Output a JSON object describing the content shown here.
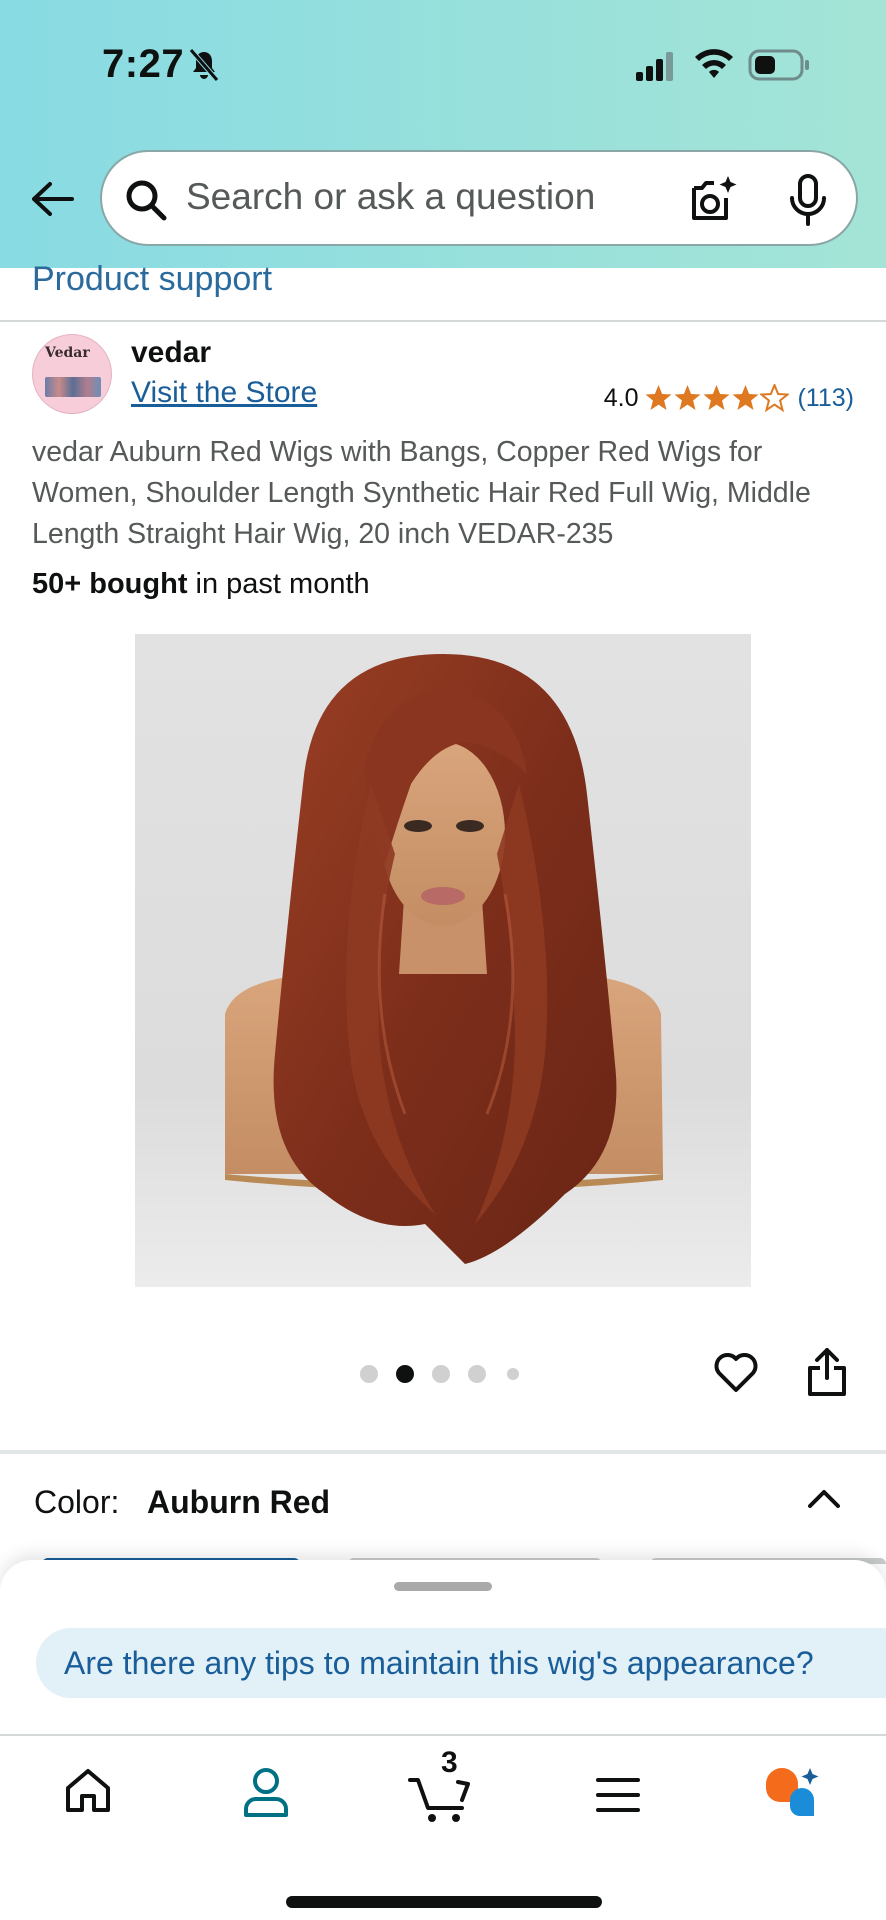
{
  "status_bar": {
    "time": "7:27"
  },
  "search": {
    "placeholder": "Search or ask a question"
  },
  "links": {
    "product_support": "Product support"
  },
  "brand": {
    "name": "vedar",
    "logo_text": "Vedar",
    "visit_store": "Visit the Store"
  },
  "rating": {
    "value": "4.0",
    "stars": 4,
    "count": "(113)"
  },
  "product": {
    "title": "vedar Auburn Red Wigs with Bangs, Copper Red Wigs for Women, Shoulder Length Synthetic Hair Red Full Wig, Middle Length Straight Hair Wig, 20 inch VEDAR-235",
    "bought_bold": "50+ bought",
    "bought_rest": " in past month",
    "image_pager": {
      "total": 5,
      "active_index": 1
    }
  },
  "variation": {
    "label": "Color:",
    "value": "Auburn Red"
  },
  "assistant": {
    "suggestion": "Are there any tips to maintain this wig's appearance?"
  },
  "tabbar": {
    "cart_count": "3"
  },
  "colors": {
    "link": "#1a5e99",
    "star": "#de7921",
    "header_gradient_start": "#88dbe3",
    "header_gradient_end": "#a4e4d6"
  }
}
